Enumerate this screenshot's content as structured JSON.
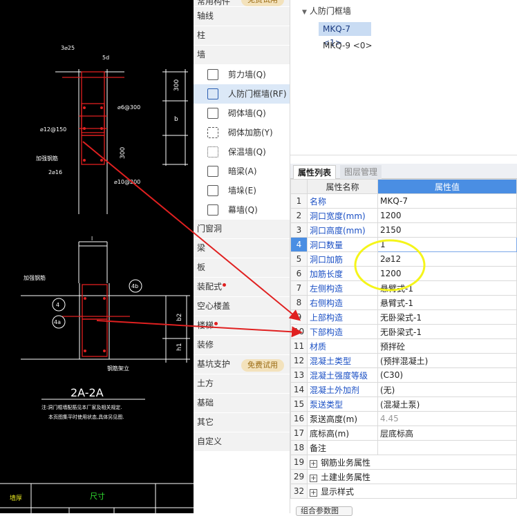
{
  "cad": {
    "title": "2A-2A",
    "note1": "注:洞门框墙配筋见本厂家及相关规定.",
    "note2": "本页图集平时使用状态,具体另见图.",
    "dim_top": "300",
    "dim_mid": "b",
    "dim_low": "300",
    "dim_a": "b2",
    "dim_h": "h1",
    "label_a": "3⌀25",
    "label_b": "5d",
    "label_c": "⌀6@300",
    "label_d": "⌀12@150",
    "label_e": "加强钢筋",
    "label_f": "2⌀16",
    "label_g": "⌀10@200",
    "label_h": "加强钢筋",
    "label_i": "钢筋架立",
    "circle_4": "4",
    "circle_4a": "4a",
    "circle_4b": "4b",
    "table_left": "墙厚",
    "table_right": "尺寸",
    "dim_l": "l"
  },
  "tree": {
    "top_partial": "常用构件",
    "top_badge": "免费试用",
    "categories": [
      {
        "label": "轴线"
      },
      {
        "label": "柱"
      },
      {
        "label": "墙"
      }
    ],
    "wall_items": [
      {
        "label": "剪力墙(Q)",
        "icon": "shear-wall-icon"
      },
      {
        "label": "人防门框墙(RF)",
        "icon": "door-frame-wall-icon",
        "selected": true
      },
      {
        "label": "砌体墙(Q)",
        "icon": "masonry-wall-icon"
      },
      {
        "label": "砌体加筋(Y)",
        "icon": "masonry-rebar-icon"
      },
      {
        "label": "保温墙(Q)",
        "icon": "insulation-wall-icon"
      },
      {
        "label": "暗梁(A)",
        "icon": "hidden-beam-icon"
      },
      {
        "label": "墙垛(E)",
        "icon": "wall-pier-icon"
      },
      {
        "label": "幕墙(Q)",
        "icon": "curtain-wall-icon"
      }
    ],
    "more_categories": [
      {
        "label": "门窗洞"
      },
      {
        "label": "梁"
      },
      {
        "label": "板"
      },
      {
        "label": "装配式"
      },
      {
        "label": "空心楼盖"
      },
      {
        "label": "楼梯"
      },
      {
        "label": "装修"
      },
      {
        "label": "基坑支护"
      },
      {
        "label": "土方"
      },
      {
        "label": "基础"
      },
      {
        "label": "其它"
      },
      {
        "label": "自定义"
      }
    ],
    "pit_badge": "免费试用"
  },
  "component_tree": {
    "group": "人防门框墙",
    "items": [
      {
        "label": "MKQ-7 <1>",
        "selected": true
      },
      {
        "label": "MKQ-9 <0>",
        "selected": false
      }
    ]
  },
  "props": {
    "tab_active": "属性列表",
    "tab_inactive": "图层管理",
    "col_name": "属性名称",
    "col_value": "属性值",
    "rows": [
      {
        "n": "1",
        "k": "名称",
        "v": "MKQ-7"
      },
      {
        "n": "2",
        "k": "洞口宽度(mm)",
        "v": "1200"
      },
      {
        "n": "3",
        "k": "洞口高度(mm)",
        "v": "2150"
      },
      {
        "n": "4",
        "k": "洞口数量",
        "v": "1"
      },
      {
        "n": "5",
        "k": "洞口加筋",
        "v": "2⌀12"
      },
      {
        "n": "6",
        "k": "加筋长度",
        "v": "1200"
      },
      {
        "n": "7",
        "k": "左侧构造",
        "v": "悬臂式-1"
      },
      {
        "n": "8",
        "k": "右侧构造",
        "v": "悬臂式-1"
      },
      {
        "n": "9",
        "k": "上部构造",
        "v": "无卧梁式-1"
      },
      {
        "n": "10",
        "k": "下部构造",
        "v": "无卧梁式-1"
      },
      {
        "n": "11",
        "k": "材质",
        "v": "预拌砼"
      },
      {
        "n": "12",
        "k": "混凝土类型",
        "v": "(预拌混凝土)"
      },
      {
        "n": "13",
        "k": "混凝土强度等级",
        "v": "(C30)"
      },
      {
        "n": "14",
        "k": "混凝土外加剂",
        "v": "(无)"
      },
      {
        "n": "15",
        "k": "泵送类型",
        "v": "(混凝土泵)"
      },
      {
        "n": "16",
        "k": "泵送高度(m)",
        "v": "4.45"
      },
      {
        "n": "17",
        "k": "底标高(m)",
        "v": "层底标高"
      },
      {
        "n": "18",
        "k": "备注",
        "v": ""
      },
      {
        "n": "19",
        "k": "钢筋业务属性",
        "v": ""
      },
      {
        "n": "29",
        "k": "土建业务属性",
        "v": ""
      },
      {
        "n": "32",
        "k": "显示样式",
        "v": ""
      }
    ],
    "bottom_button": "组合参数图"
  },
  "colors": {
    "accent": "#4a8ee3",
    "annotation_arrow": "#e02020",
    "highlight_circle": "#f5f51a"
  }
}
